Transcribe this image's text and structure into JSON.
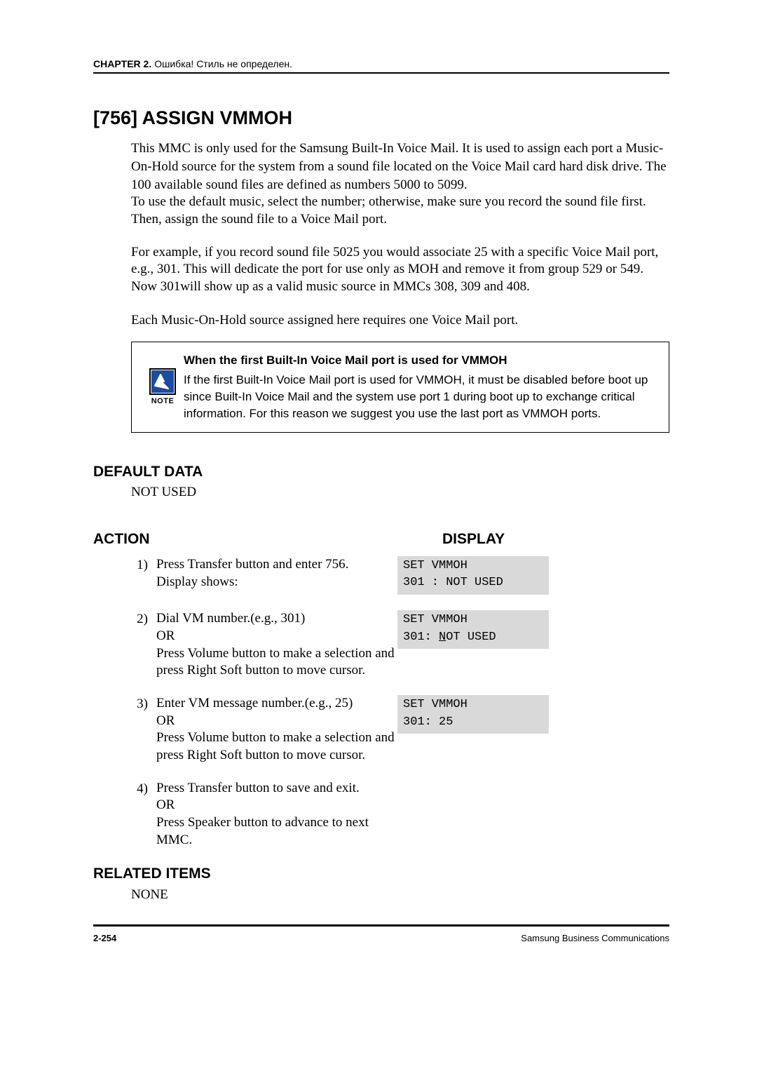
{
  "header": {
    "chapter_label": "CHAPTER 2.",
    "chapter_text": "Ошибка! Стиль не определен."
  },
  "title": "[756] ASSIGN VMMOH",
  "intro": {
    "p1": "This MMC is only used for the Samsung Built-In Voice Mail. It is used to assign each port a Music-On-Hold source for the system from a sound file located on the Voice Mail card hard disk drive. The 100 available sound files are defined as numbers 5000 to 5099.",
    "p2": "To use the default music, select the number; otherwise, make sure you record the sound file first. Then, assign the sound file to a Voice Mail port.",
    "p3": "For example, if you record sound file 5025 you would associate 25 with a specific Voice Mail port, e.g., 301. This will dedicate the port for use only as MOH and remove it from group 529 or 549. Now 301will show up as a valid music source in MMCs 308, 309 and 408.",
    "p4": "Each Music-On-Hold source assigned here requires one Voice Mail port."
  },
  "note": {
    "label": "NOTE",
    "title": "When the first Built-In Voice Mail port is used for VMMOH",
    "body": "If the first Built-In Voice Mail port is used for VMMOH, it must be disabled before boot up since Built-In Voice Mail and the system use port 1 during boot up to exchange critical information. For this reason we suggest you use the last port as VMMOH ports."
  },
  "default_data": {
    "heading": "DEFAULT DATA",
    "value": "NOT USED"
  },
  "action_heading": "ACTION",
  "display_heading": "DISPLAY",
  "steps": [
    {
      "num": "1)",
      "text1": "Press Transfer button and enter 756.",
      "text2": "Display shows:",
      "disp_line1": "SET VMMOH",
      "disp_line2": "301 : NOT USED"
    },
    {
      "num": "2)",
      "text1": "Dial VM number.(e.g., 301)",
      "text_or": "OR",
      "text2": "Press Volume button to make a selection and press Right Soft button to move cursor.",
      "disp_line1": "SET VMMOH",
      "disp_line2_pre": "301: ",
      "disp_line2_u": "N",
      "disp_line2_post": "OT USED"
    },
    {
      "num": "3)",
      "text1": "Enter VM message number.(e.g., 25)",
      "text_or": "OR",
      "text2": "Press Volume button to make a selection and press Right Soft button to move cursor.",
      "disp_line1": "SET VMMOH",
      "disp_line2": "301: 25"
    },
    {
      "num": "4)",
      "text1": "Press Transfer button to save and exit.",
      "text_or": "OR",
      "text2": "Press Speaker button to advance to next MMC."
    }
  ],
  "related": {
    "heading": "RELATED ITEMS",
    "value": "NONE"
  },
  "footer": {
    "page": "2-254",
    "company": "Samsung Business Communications"
  }
}
